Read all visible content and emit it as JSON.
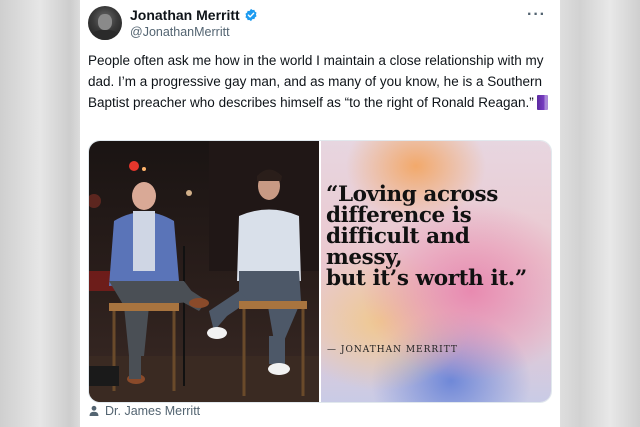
{
  "tweet": {
    "author": {
      "display_name": "Jonathan Merritt",
      "handle": "@JonathanMerritt",
      "verified": true
    },
    "text": "People often ask me how in the world I maintain a close relationship with my dad. I’m a progressive gay man, and as many of you know, he is a Southern Baptist preacher who describes himself as “to the right of Ronald Reagan.”",
    "emoji": "book-icon",
    "media": {
      "photo_description_icon": "photo",
      "quote": {
        "lines": [
          "“Loving across",
          "difference is",
          "difficult and",
          "messy,",
          "but it’s worth it.”"
        ],
        "attribution": "— JONATHAN MERRITT"
      }
    },
    "tagged_user": "Dr. James Merritt"
  },
  "icons": {
    "verified": "verified-badge-icon",
    "more": "more-icon",
    "tag": "person-icon"
  },
  "colors": {
    "verified": "#1d9bf0",
    "text": "#0f1419",
    "secondary": "#536471"
  }
}
